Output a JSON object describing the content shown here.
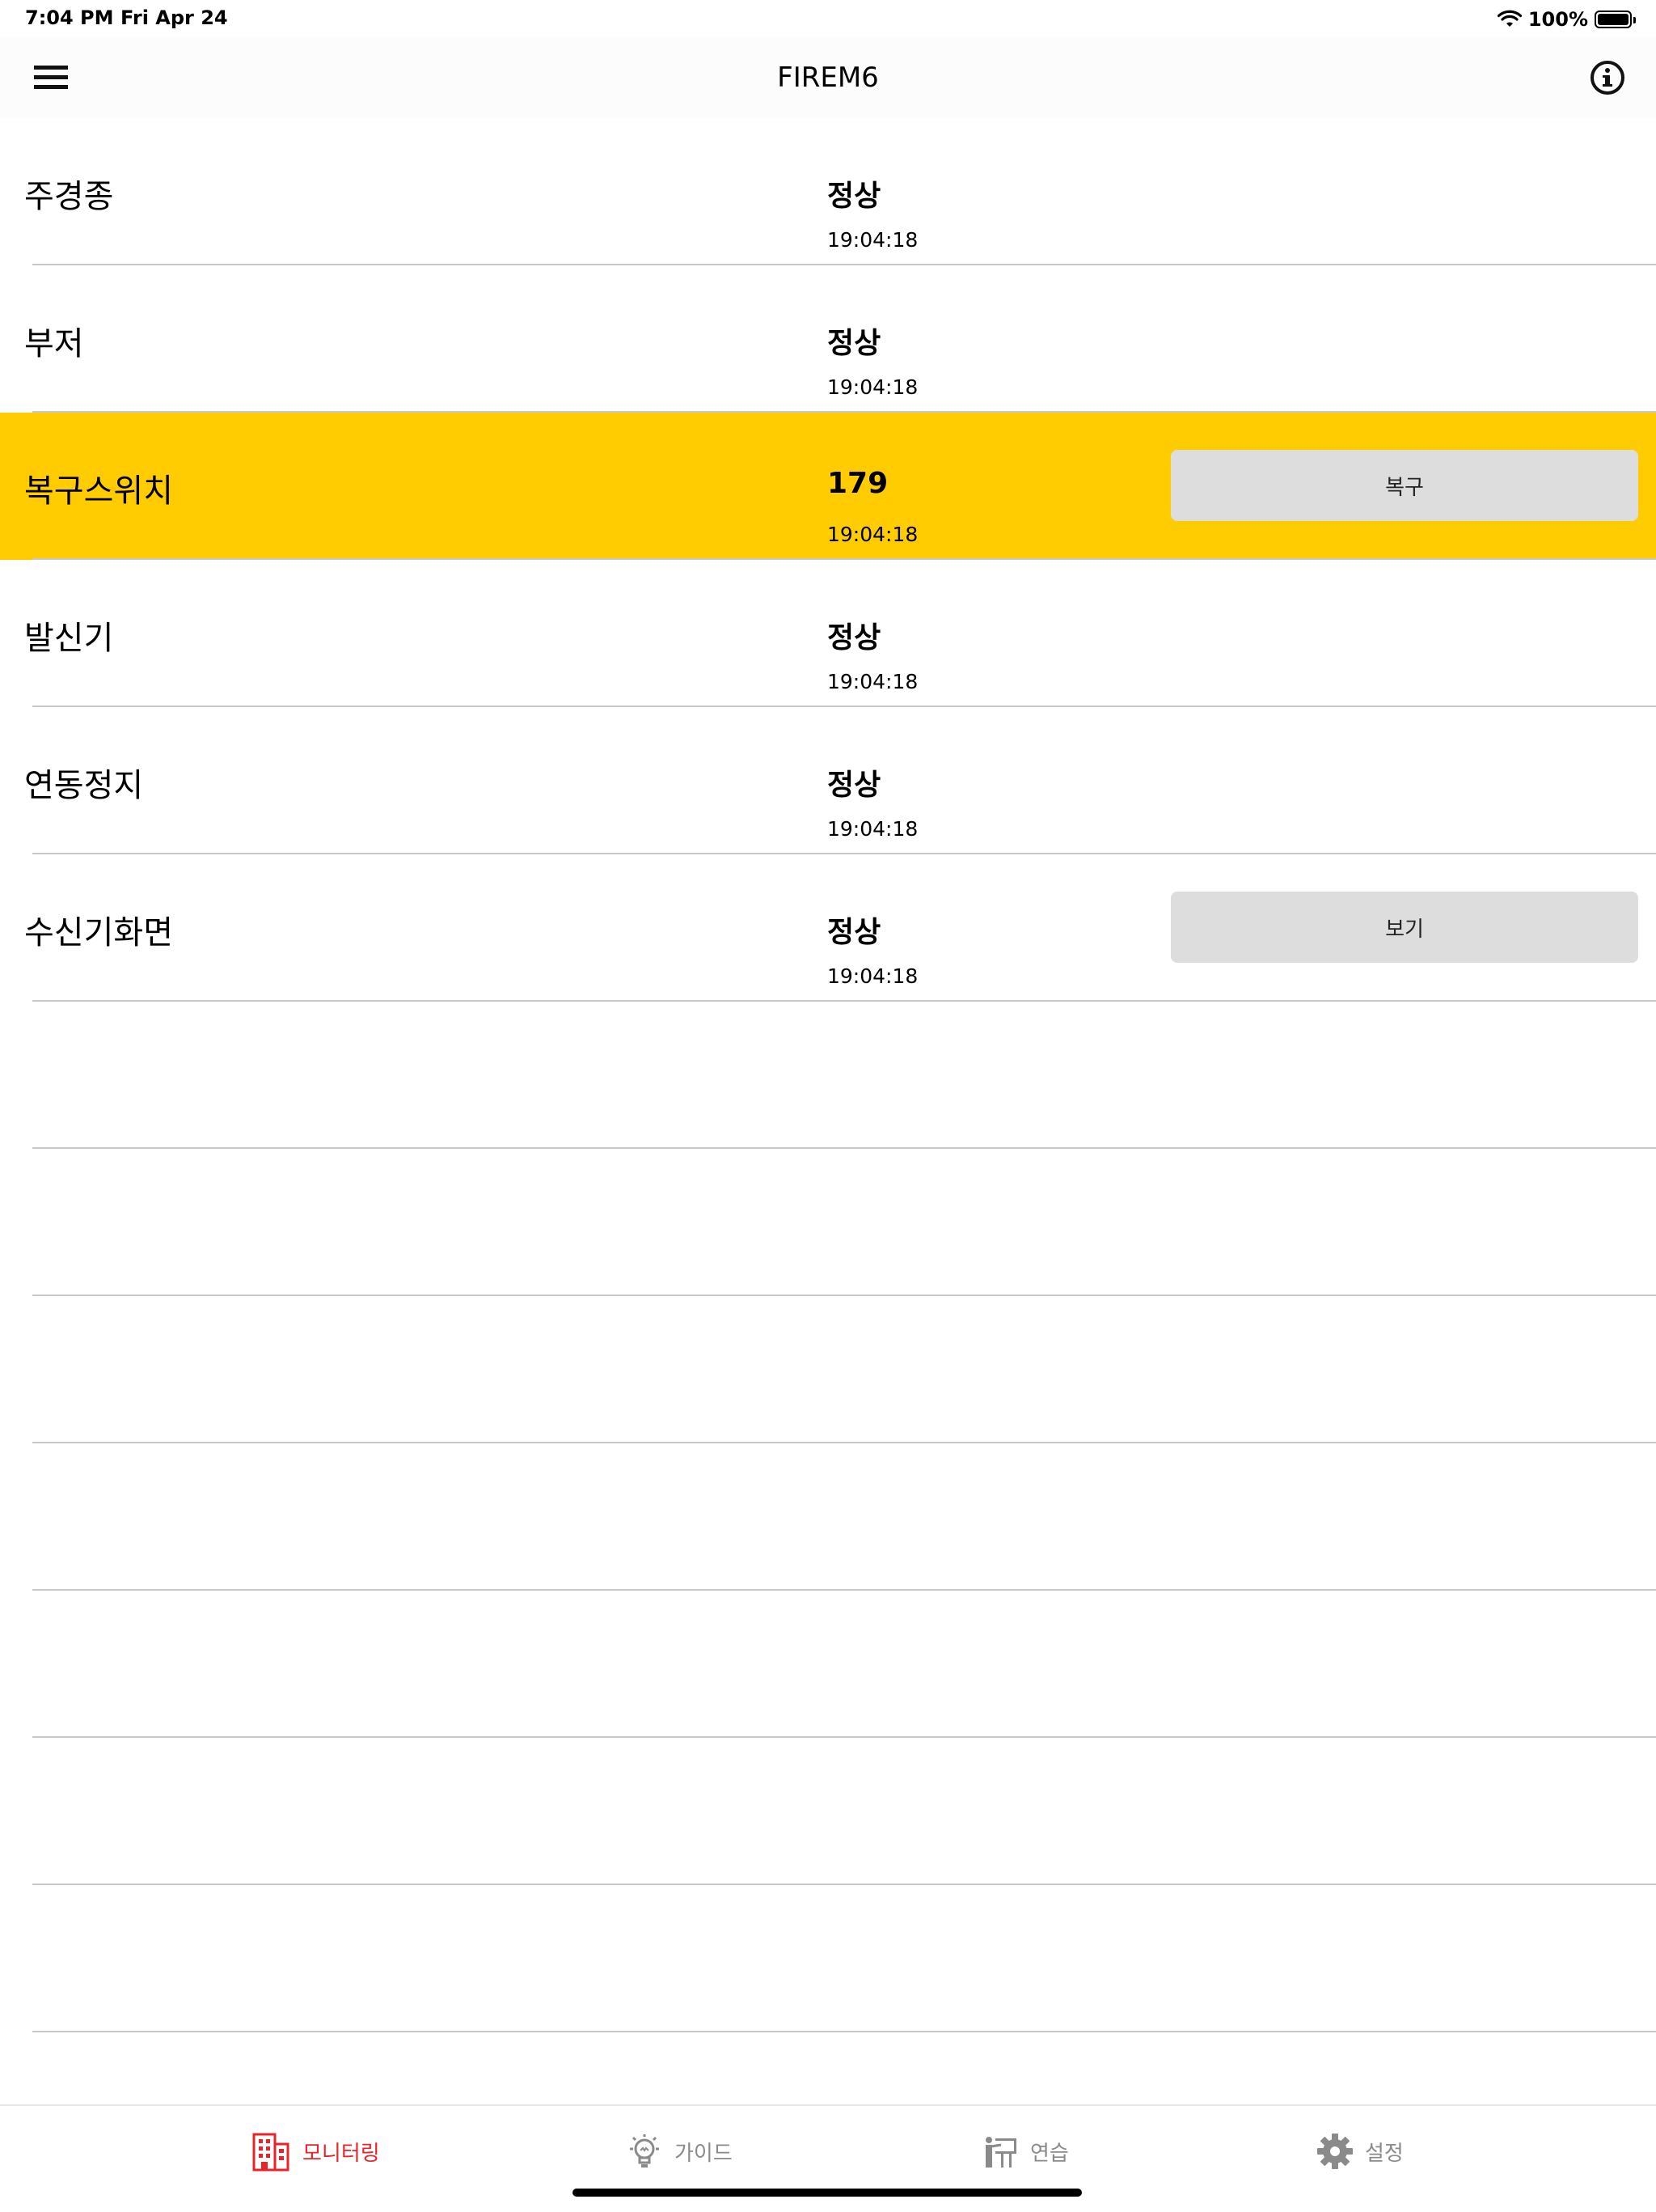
{
  "status_bar": {
    "time": "7:04 PM",
    "date": "Fri Apr 24",
    "battery": "100%"
  },
  "nav": {
    "title": "FIREM6",
    "menu_icon": "hamburger-menu-icon",
    "info_icon": "info-circle-icon"
  },
  "rows": [
    {
      "label": "주경종",
      "status": "정상",
      "time": "19:04:18"
    },
    {
      "label": "부저",
      "status": "정상",
      "time": "19:04:18"
    },
    {
      "label": "복구스위치",
      "status": "179",
      "time": "19:04:18",
      "button": "복구",
      "highlight_color": "#fecc00"
    },
    {
      "label": "발신기",
      "status": "정상",
      "time": "19:04:18"
    },
    {
      "label": "연동정지",
      "status": "정상",
      "time": "19:04:18"
    },
    {
      "label": "수신기화면",
      "status": "정상",
      "time": "19:04:18",
      "button": "보기"
    }
  ],
  "tabs": [
    {
      "label": "모니터링",
      "icon": "building-icon",
      "active": true
    },
    {
      "label": "가이드",
      "icon": "lightbulb-icon",
      "active": false
    },
    {
      "label": "연습",
      "icon": "presentation-icon",
      "active": false
    },
    {
      "label": "설정",
      "icon": "gear-icon",
      "active": false
    }
  ],
  "colors": {
    "accent": "#e8232a",
    "alert_row": "#fecc00",
    "button_bg": "#dddddd",
    "inactive_tab": "#8a8a8a"
  }
}
